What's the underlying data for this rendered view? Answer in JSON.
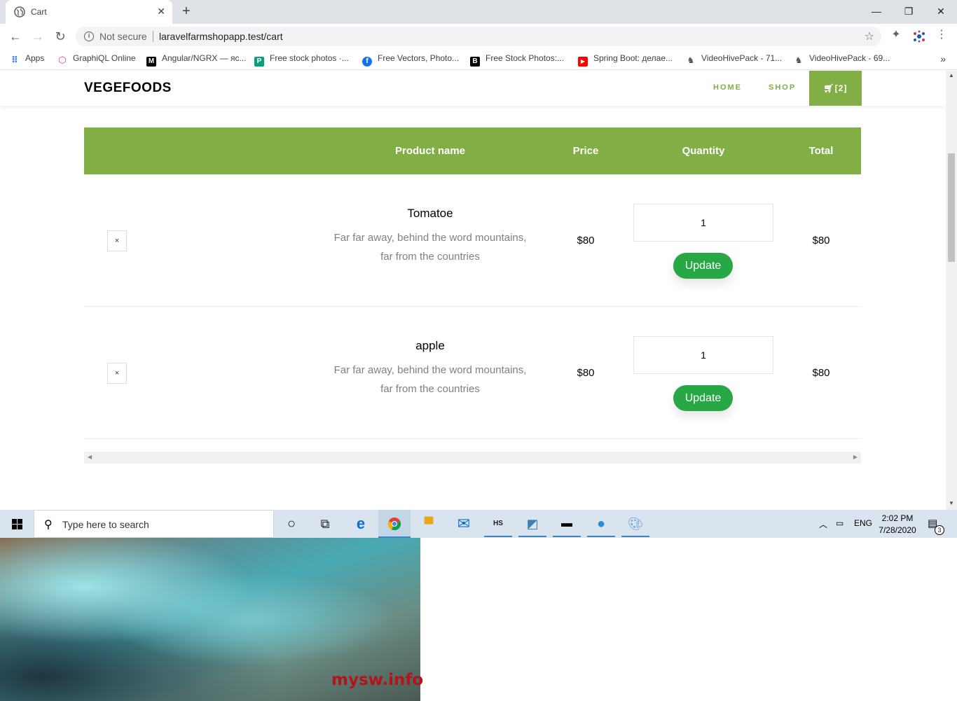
{
  "browser": {
    "tab_title": "Cart",
    "not_secure": "Not secure",
    "url": "laravelfarmshopapp.test/cart",
    "bookmarks": [
      "Apps",
      "GraphiQL Online",
      "Angular/NGRX — яс...",
      "Free stock photos ·...",
      "Free Vectors, Photo...",
      "Free Stock Photos:...",
      "Spring Boot: делае...",
      "VideoHivePack - 71...",
      "VideoHivePack - 69..."
    ]
  },
  "site": {
    "brand": "VEGEFOODS",
    "nav": {
      "home": "HOME",
      "shop": "SHOP",
      "cart": "[2]"
    }
  },
  "cart": {
    "columns": {
      "name": "Product name",
      "price": "Price",
      "quantity": "Quantity",
      "total": "Total"
    },
    "remove_symbol": "×",
    "update_label": "Update",
    "items": [
      {
        "name": "Tomatoe",
        "desc_line1": "Far far away, behind the word mountains,",
        "desc_line2": "far from the countries",
        "price": "$80",
        "quantity": "1",
        "total": "$80"
      },
      {
        "name": "apple",
        "desc_line1": "Far far away, behind the word mountains,",
        "desc_line2": "far from the countries",
        "price": "$80",
        "quantity": "1",
        "total": "$80"
      }
    ]
  },
  "taskbar": {
    "search_placeholder": "Type here to search",
    "language": "ENG",
    "time": "2:02 PM",
    "date": "7/28/2020",
    "notification_count": "3"
  },
  "desktop": {
    "watermark": "mysw.info"
  },
  "colors": {
    "accent": "#82ae46",
    "update_button": "#28a745"
  }
}
